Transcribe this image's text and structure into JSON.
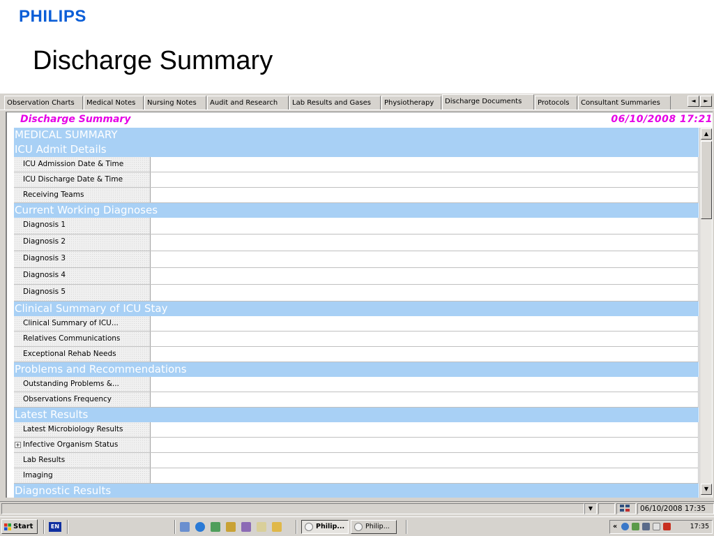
{
  "slide": {
    "logo": "PHILIPS",
    "title": "Discharge Summary"
  },
  "tabs": [
    {
      "label": "Observation Charts",
      "active": false
    },
    {
      "label": "Medical Notes",
      "active": false
    },
    {
      "label": "Nursing Notes",
      "active": false
    },
    {
      "label": "Audit and Research",
      "active": false
    },
    {
      "label": "Lab Results and Gases",
      "active": false
    },
    {
      "label": "Physiotherapy",
      "active": false
    },
    {
      "label": "Discharge Documents",
      "active": true
    },
    {
      "label": "Protocols",
      "active": false
    },
    {
      "label": "Consultant Summaries",
      "active": false
    }
  ],
  "tab_scroll": {
    "left": "◄",
    "right": "►"
  },
  "panel": {
    "title": "Discharge Summary",
    "datetime": "06/10/2008  17:21"
  },
  "sections": {
    "medical_summary": "MEDICAL SUMMARY",
    "icu_admit": {
      "title": "ICU Admit Details",
      "fields": [
        "ICU Admission Date & Time",
        "ICU Discharge Date & Time",
        "Receiving Teams"
      ]
    },
    "diagnoses": {
      "title": "Current Working Diagnoses",
      "fields": [
        "Diagnosis 1",
        "Diagnosis 2",
        "Diagnosis 3",
        "Diagnosis 4",
        "Diagnosis 5"
      ]
    },
    "clinical": {
      "title": "Clinical Summary of ICU Stay",
      "fields": [
        "Clinical Summary of ICU...",
        "Relatives Communications",
        "Exceptional Rehab Needs"
      ]
    },
    "problems": {
      "title": "Problems and Recommendations",
      "fields": [
        "Outstanding Problems &...",
        "Observations Frequency"
      ]
    },
    "latest": {
      "title": "Latest Results",
      "fields": [
        "Latest Microbiology Results",
        "Infective Organism Status",
        "Lab Results",
        "Imaging"
      ],
      "expander": "+"
    },
    "diagnostic": {
      "title": "Diagnostic Results"
    }
  },
  "scrollbar": {
    "up": "▲",
    "down": "▼"
  },
  "statusbar": {
    "dropdown": "▼",
    "datetime": "06/10/2008 17:35"
  },
  "taskbar": {
    "start": "Start",
    "language": "EN",
    "tasks": [
      {
        "label": "Philip...",
        "active": true
      },
      {
        "label": "Philip...",
        "active": false
      }
    ],
    "tray_chevron": "«",
    "clock": "17:35"
  },
  "colors": {
    "brand": "#0b5ed7",
    "section_header": "#a8d0f5",
    "panel_title": "#e600e6",
    "chrome": "#d6d3ce"
  }
}
